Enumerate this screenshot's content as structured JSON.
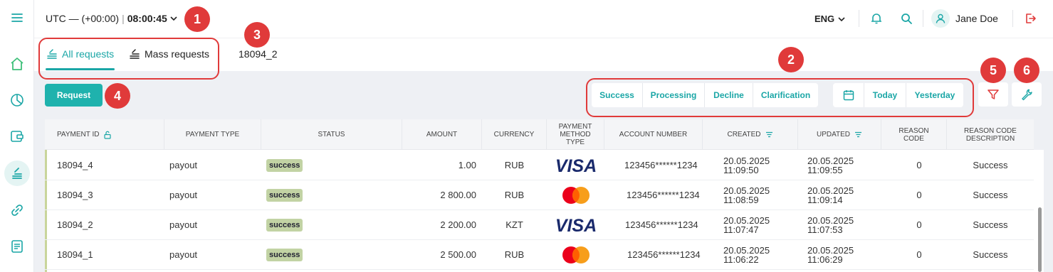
{
  "topbar": {
    "timezone": "UTC — (+00:00)",
    "time": "08:00:45",
    "language": "ENG",
    "user_name": "Jane Doe"
  },
  "tabs": [
    {
      "label": "All requests",
      "active": true
    },
    {
      "label": "Mass requests",
      "active": false
    },
    {
      "label": "18094_2",
      "active": false
    }
  ],
  "toolbar": {
    "request_label": "Request",
    "status_filters": [
      "Success",
      "Processing",
      "Decline",
      "Clarification"
    ],
    "date_filters": [
      "Today",
      "Yesterday"
    ]
  },
  "annotations": [
    "1",
    "2",
    "3",
    "4",
    "5",
    "6"
  ],
  "table": {
    "columns": [
      "PAYMENT ID",
      "PAYMENT TYPE",
      "STATUS",
      "AMOUNT",
      "CURRENCY",
      "PAYMENT METHOD TYPE",
      "ACCOUNT NUMBER",
      "CREATED",
      "UPDATED",
      "REASON CODE",
      "REASON CODE DESCRIPTION"
    ],
    "rows": [
      {
        "id": "18094_4",
        "type": "payout",
        "status": "success",
        "amount": "1.00",
        "currency": "RUB",
        "method": "visa-icon",
        "account": "123456******1234",
        "created_date": "20.05.2025",
        "created_time": "11:09:50",
        "updated_date": "20.05.2025",
        "updated_time": "11:09:55",
        "reason_code": "0",
        "reason_desc": "Success"
      },
      {
        "id": "18094_3",
        "type": "payout",
        "status": "success",
        "amount": "2 800.00",
        "currency": "RUB",
        "method": "mastercard-icon",
        "account": "123456******1234",
        "created_date": "20.05.2025",
        "created_time": "11:08:59",
        "updated_date": "20.05.2025",
        "updated_time": "11:09:14",
        "reason_code": "0",
        "reason_desc": "Success"
      },
      {
        "id": "18094_2",
        "type": "payout",
        "status": "success",
        "amount": "2 200.00",
        "currency": "KZT",
        "method": "visa-icon",
        "account": "123456******1234",
        "created_date": "20.05.2025",
        "created_time": "11:07:47",
        "updated_date": "20.05.2025",
        "updated_time": "11:07:53",
        "reason_code": "0",
        "reason_desc": "Success"
      },
      {
        "id": "18094_1",
        "type": "payout",
        "status": "success",
        "amount": "2 500.00",
        "currency": "RUB",
        "method": "mastercard-icon",
        "account": "123456******1234",
        "created_date": "20.05.2025",
        "created_time": "11:06:22",
        "updated_date": "20.05.2025",
        "updated_time": "11:06:29",
        "reason_code": "0",
        "reason_desc": "Success"
      }
    ]
  },
  "colors": {
    "accent": "#1aa6a6",
    "annotation": "#e03a3a",
    "success_badge": "#c2d3a4"
  }
}
